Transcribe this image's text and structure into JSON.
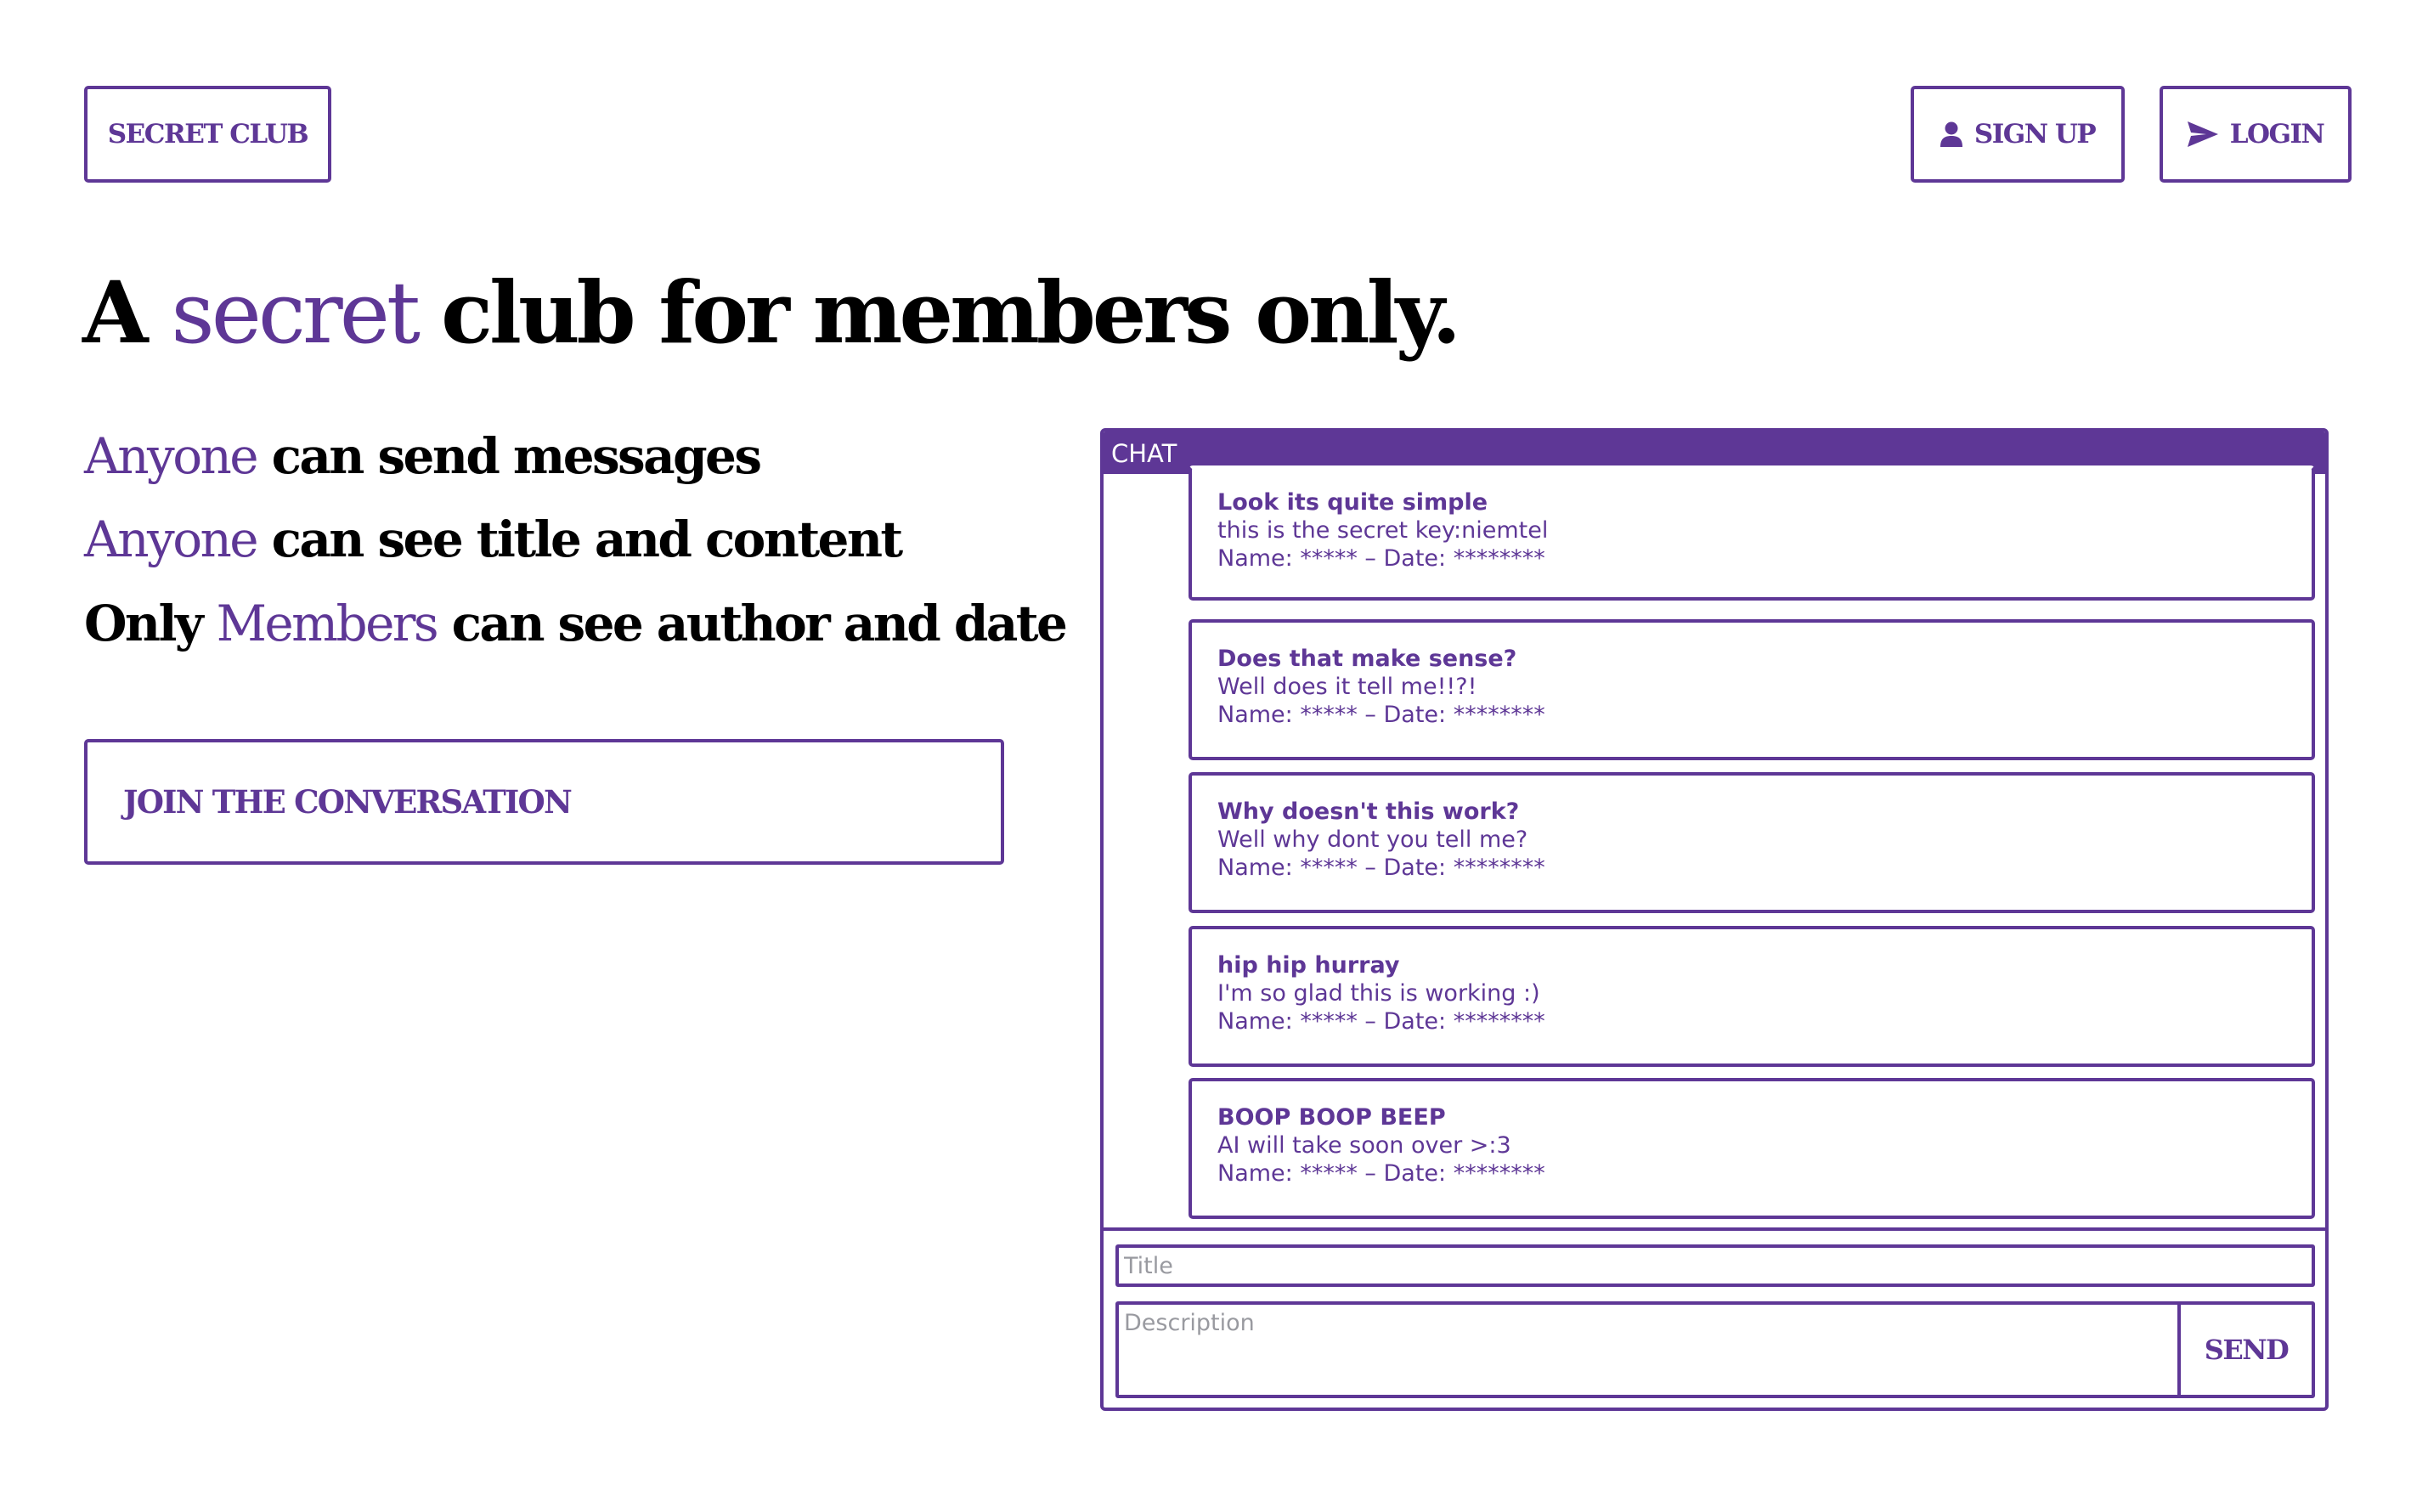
{
  "nav": {
    "brand": "SECRET CLUB",
    "signup_label": "SIGN UP",
    "login_label": "LOGIN",
    "signup_icon": "user-icon",
    "login_icon": "send-arrow-icon"
  },
  "hero": {
    "title_prefix": "A",
    "title_accent": "secret",
    "title_suffix": "club for members only.",
    "rules": [
      {
        "accent_first": "Anyone",
        "text": " can send messages"
      },
      {
        "accent_first": "Anyone",
        "text": " can see title and content"
      },
      {
        "prefix": "Only ",
        "accent": "Members",
        "text": " can see author and date"
      }
    ],
    "cta_label": "JOIN THE CONVERSATION"
  },
  "chat": {
    "header": "CHAT",
    "messages": [
      {
        "title": "Look its quite simple",
        "body": "this is the secret key:niemtel",
        "meta": "Name: ***** – Date: ********"
      },
      {
        "title": "Does that make sense?",
        "body": "Well does it tell me!!?!",
        "meta": "Name: ***** – Date: ********"
      },
      {
        "title": "Why doesn't this work?",
        "body": "Well why dont you tell me?",
        "meta": "Name: ***** – Date: ********"
      },
      {
        "title": "hip hip hurray",
        "body": "I'm so glad this is working :)",
        "meta": "Name: ***** – Date: ********"
      },
      {
        "title": "BOOP BOOP BEEP",
        "body": "AI will take soon over >:3",
        "meta": "Name: ***** – Date: ********"
      }
    ],
    "title_placeholder": "Title",
    "description_placeholder": "Description",
    "send_label": "SEND"
  },
  "colors": {
    "accent": "#5e3796",
    "background": "#ffffff",
    "text": "#000000",
    "placeholder": "#999aa0"
  }
}
